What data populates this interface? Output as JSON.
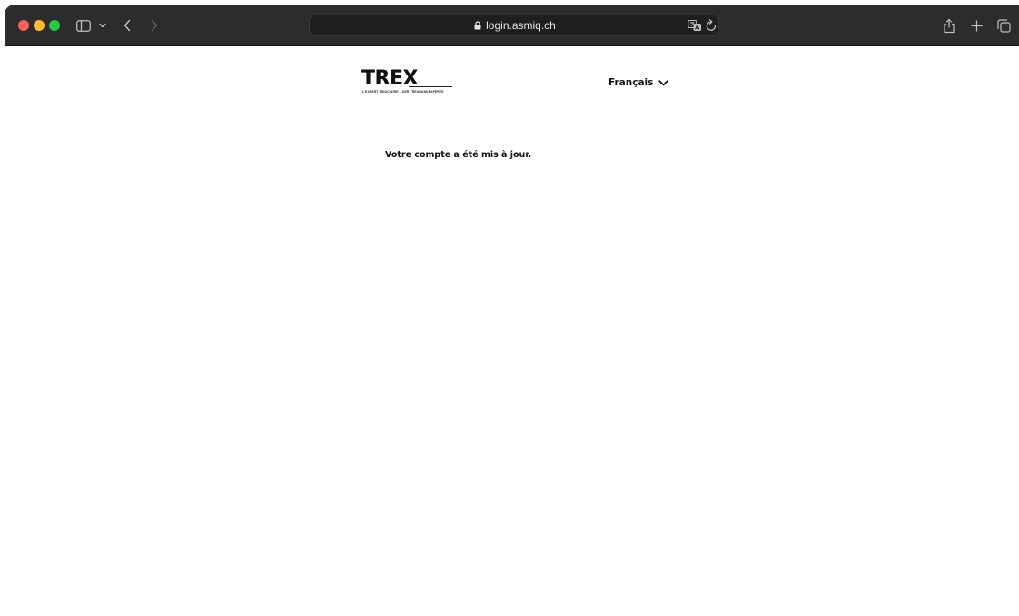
{
  "browser": {
    "url": "login.asmiq.ch"
  },
  "page": {
    "logo": {
      "wordmark": "TREX",
      "tagline": "L'EXPERT FIDUCIAIRE – DER TREUHANDEXPERTE"
    },
    "language": {
      "selected": "Français"
    },
    "message": "Votre compte a été mis à jour."
  },
  "colors": {
    "titlebar": "#2c2c2e",
    "close": "#fe5f57",
    "minimize": "#febc2e",
    "maximize": "#28c840",
    "text": "#111111"
  },
  "icons": {
    "sidebar": "sidebar-icon",
    "back": "chevron-left-icon",
    "forward": "chevron-right-icon",
    "lock": "lock-icon",
    "translate": "translate-icon",
    "reload": "reload-icon",
    "share": "share-icon",
    "new_tab": "plus-icon",
    "tabs": "tab-overview-icon",
    "language": "chevron-down-icon"
  }
}
